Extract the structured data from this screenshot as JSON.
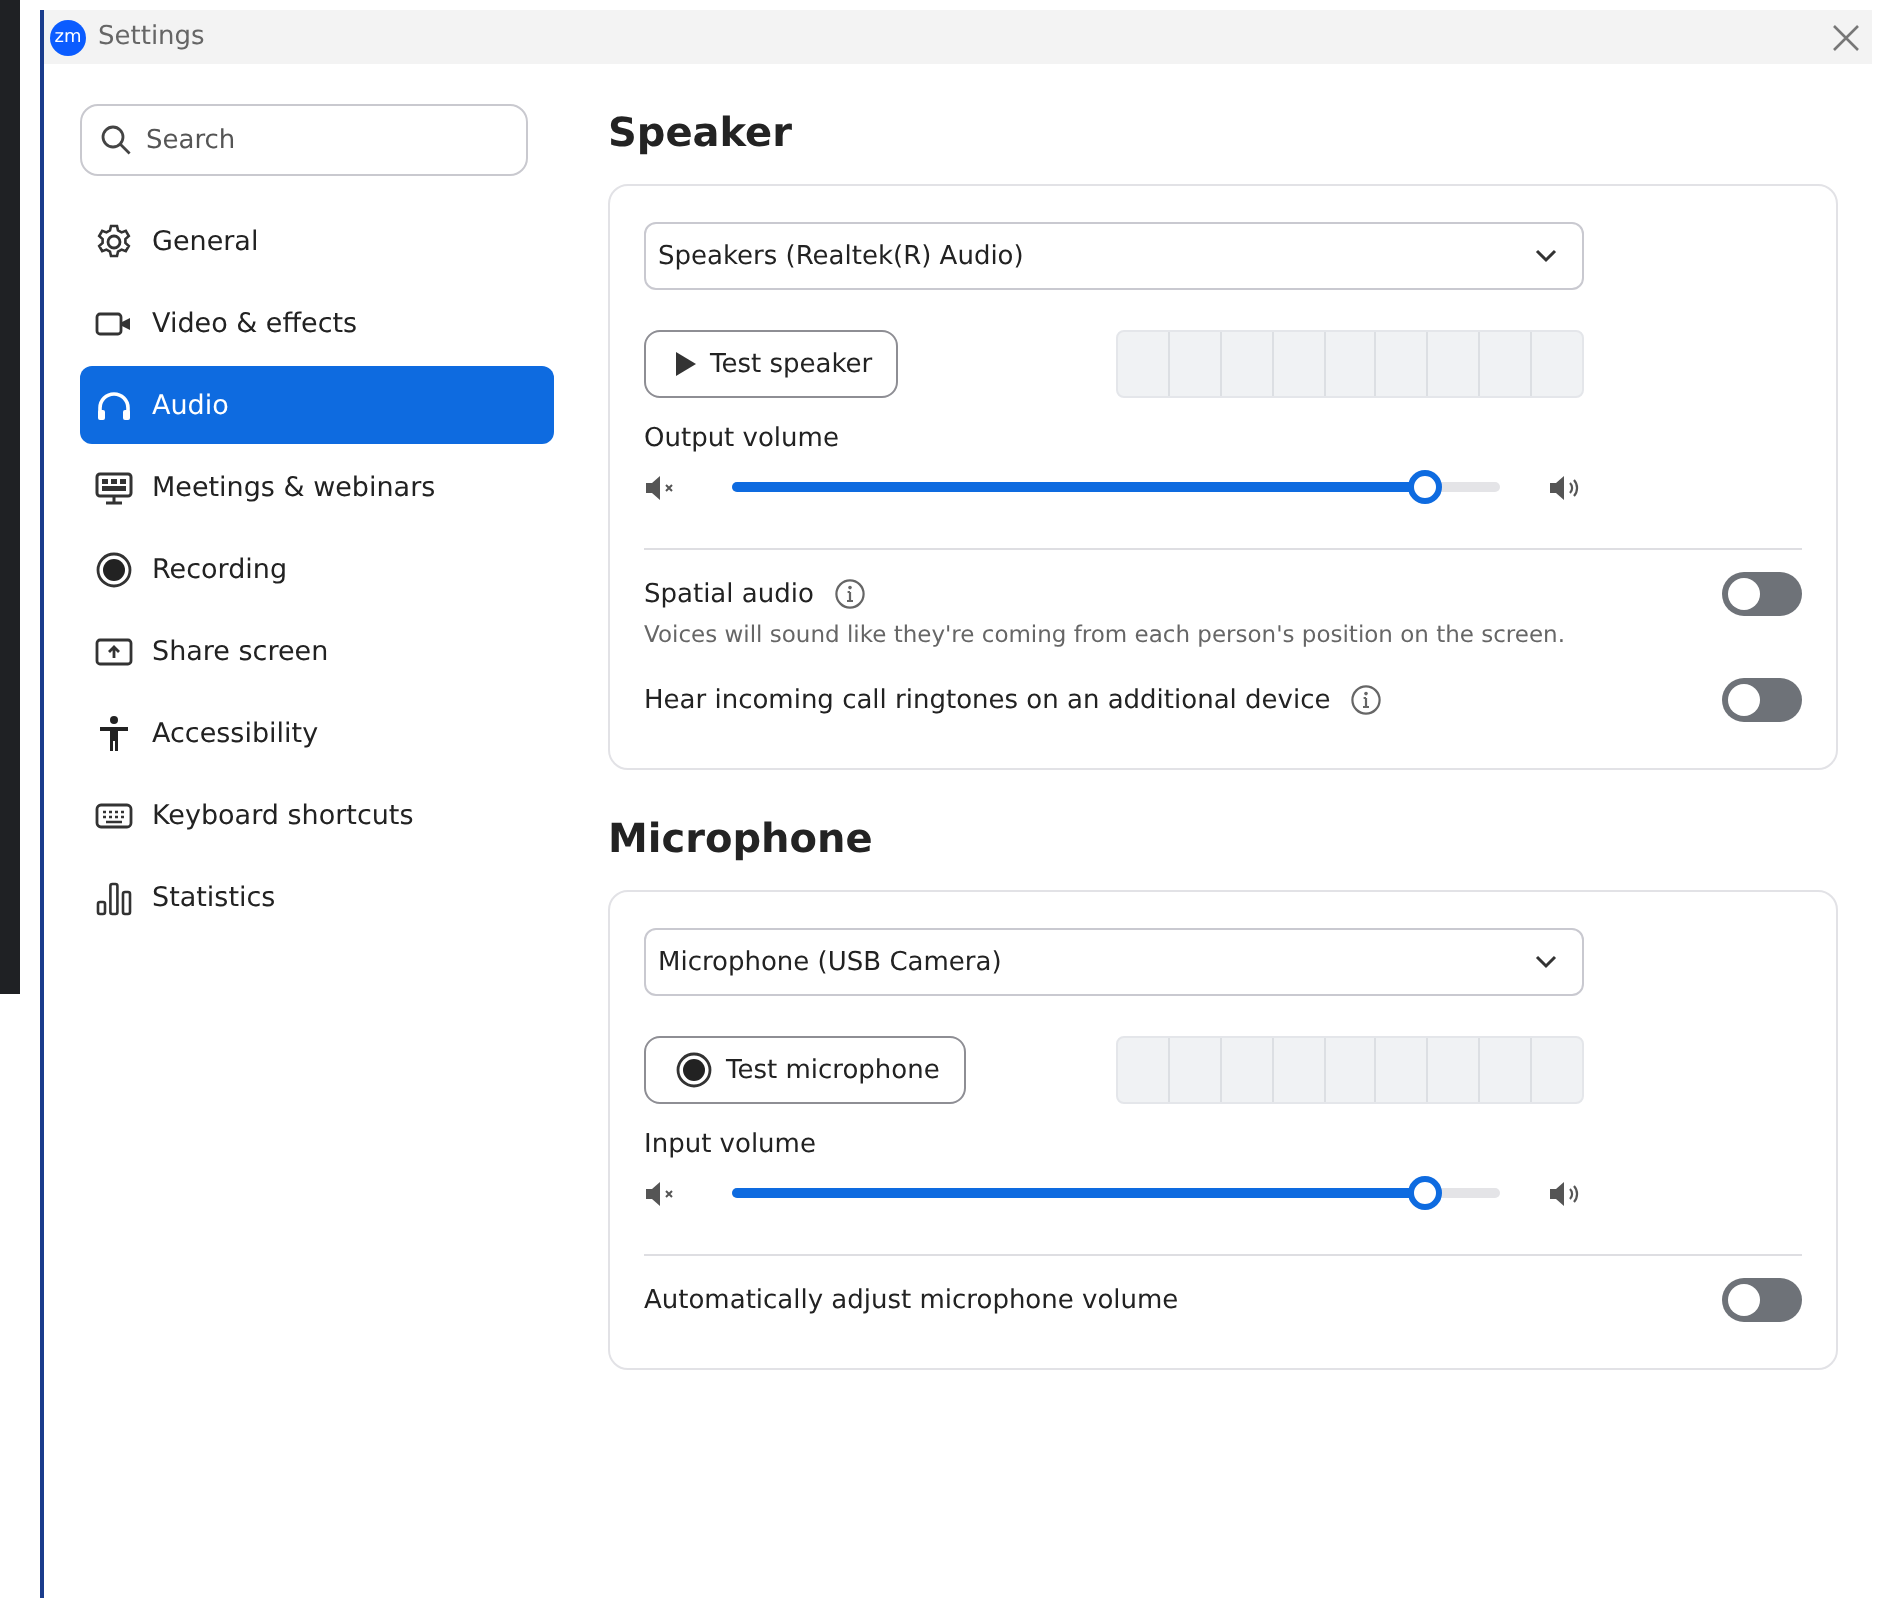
{
  "window": {
    "title": "Settings",
    "logo": "zm"
  },
  "search": {
    "placeholder": "Search"
  },
  "sidebar": {
    "items": [
      {
        "label": "General",
        "selected": false
      },
      {
        "label": "Video & effects",
        "selected": false
      },
      {
        "label": "Audio",
        "selected": true
      },
      {
        "label": "Meetings & webinars",
        "selected": false
      },
      {
        "label": "Recording",
        "selected": false
      },
      {
        "label": "Share screen",
        "selected": false
      },
      {
        "label": "Accessibility",
        "selected": false
      },
      {
        "label": "Keyboard shortcuts",
        "selected": false
      },
      {
        "label": "Statistics",
        "selected": false
      }
    ]
  },
  "sections": [
    {
      "title": "Speaker",
      "device": "Speakers (Realtek(R) Audio)",
      "test_button": {
        "label": "Test speaker"
      },
      "meter": {
        "level": 0
      },
      "volume": {
        "label": "Output volume",
        "level": 0.9
      },
      "toggles": [
        {
          "label": "Spatial audio",
          "info": true,
          "description": "Voices will sound like they're coming from each person's position on the screen.",
          "on": false
        },
        {
          "label": "Hear incoming call ringtones on an additional device",
          "info": true,
          "on": false
        }
      ]
    },
    {
      "title": "Microphone",
      "device": "Microphone (USB Camera)",
      "test_button": {
        "label": "Test microphone"
      },
      "meter": {
        "level": 0
      },
      "volume": {
        "label": "Input volume",
        "level": 0.9
      },
      "toggles": [
        {
          "label": "Automatically adjust microphone volume",
          "info": false,
          "on": false
        }
      ]
    }
  ]
}
